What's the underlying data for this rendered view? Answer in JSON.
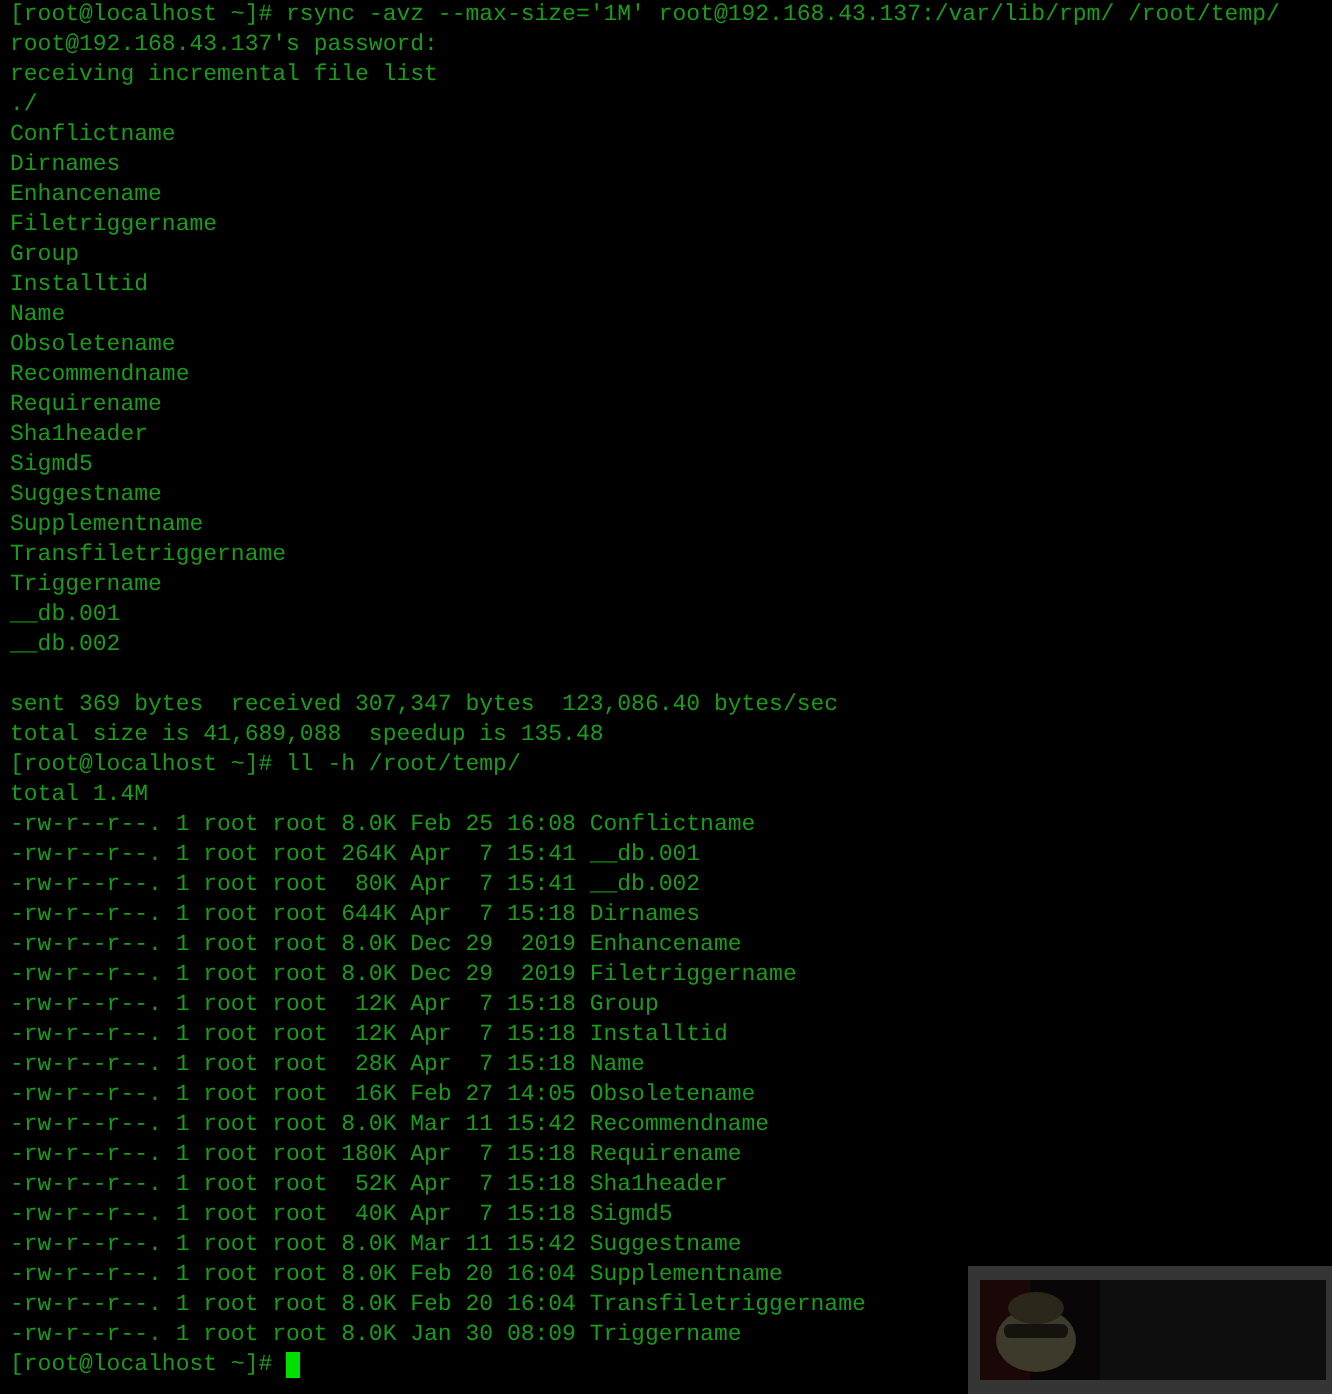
{
  "terminal": {
    "blocks": [
      [
        "[root@localhost ~]# rsync -avz --max-size='1M' root@192.168.43.137:/var/lib/rpm/ /root/temp/",
        "root@192.168.43.137's password:",
        "receiving incremental file list",
        "./",
        "Conflictname",
        "Dirnames",
        "Enhancename",
        "Filetriggername",
        "Group",
        "Installtid",
        "Name",
        "Obsoletename",
        "Recommendname",
        "Requirename",
        "Sha1header",
        "Sigmd5",
        "Suggestname",
        "Supplementname",
        "Transfiletriggername",
        "Triggername",
        "__db.001",
        "__db.002"
      ],
      [
        "sent 369 bytes  received 307,347 bytes  123,086.40 bytes/sec",
        "total size is 41,689,088  speedup is 135.48",
        "[root@localhost ~]# ll -h /root/temp/",
        "total 1.4M",
        "-rw-r--r--. 1 root root 8.0K Feb 25 16:08 Conflictname",
        "-rw-r--r--. 1 root root 264K Apr  7 15:41 __db.001",
        "-rw-r--r--. 1 root root  80K Apr  7 15:41 __db.002",
        "-rw-r--r--. 1 root root 644K Apr  7 15:18 Dirnames",
        "-rw-r--r--. 1 root root 8.0K Dec 29  2019 Enhancename",
        "-rw-r--r--. 1 root root 8.0K Dec 29  2019 Filetriggername",
        "-rw-r--r--. 1 root root  12K Apr  7 15:18 Group",
        "-rw-r--r--. 1 root root  12K Apr  7 15:18 Installtid",
        "-rw-r--r--. 1 root root  28K Apr  7 15:18 Name",
        "-rw-r--r--. 1 root root  16K Feb 27 14:05 Obsoletename",
        "-rw-r--r--. 1 root root 8.0K Mar 11 15:42 Recommendname",
        "-rw-r--r--. 1 root root 180K Apr  7 15:18 Requirename",
        "-rw-r--r--. 1 root root  52K Apr  7 15:18 Sha1header",
        "-rw-r--r--. 1 root root  40K Apr  7 15:18 Sigmd5",
        "-rw-r--r--. 1 root root 8.0K Mar 11 15:42 Suggestname",
        "-rw-r--r--. 1 root root 8.0K Feb 20 16:04 Supplementname",
        "-rw-r--r--. 1 root root 8.0K Feb 20 16:04 Transfiletriggername",
        "-rw-r--r--. 1 root root 8.0K Jan 30 08:09 Triggername"
      ]
    ],
    "prompt": "[root@localhost ~]#",
    "cursor_visible": true
  }
}
